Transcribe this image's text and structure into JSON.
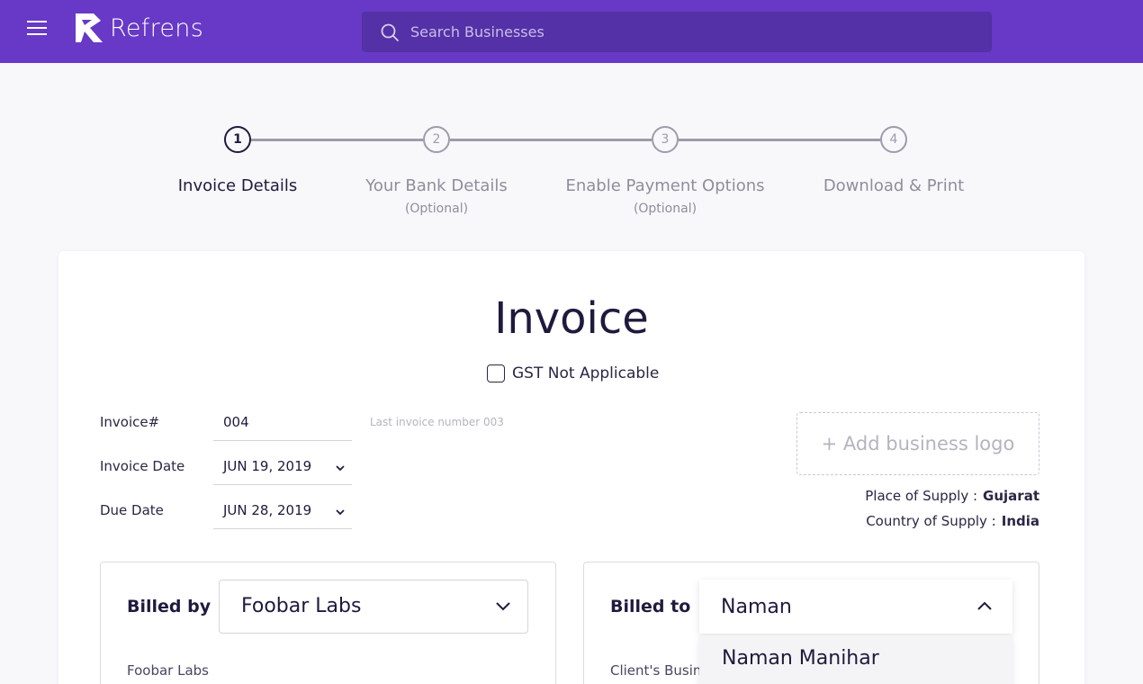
{
  "brand": {
    "name": "Refrens",
    "color": "#6739c6"
  },
  "search": {
    "placeholder": "Search Businesses"
  },
  "steps": [
    {
      "number": "1",
      "label": "Invoice Details",
      "sub": ""
    },
    {
      "number": "2",
      "label": "Your Bank Details",
      "sub": "(Optional)"
    },
    {
      "number": "3",
      "label": "Enable Payment Options",
      "sub": "(Optional)"
    },
    {
      "number": "4",
      "label": "Download & Print",
      "sub": ""
    }
  ],
  "invoice": {
    "title": "Invoice",
    "gst_label": "GST Not Applicable",
    "gst_checked": false,
    "number_label": "Invoice#",
    "number_value": "004",
    "number_hint": "Last invoice number 003",
    "date_label": "Invoice Date",
    "date_value": "JUN 19, 2019",
    "due_label": "Due Date",
    "due_value": "JUN 28, 2019",
    "add_logo": "+ Add business logo",
    "place_label": "Place of Supply :",
    "place_value": "Gujarat",
    "country_label": "Country of Supply :",
    "country_value": "India"
  },
  "billed_by": {
    "title": "Billed by",
    "selected": "Foobar Labs",
    "business_name": "Foobar Labs"
  },
  "billed_to": {
    "title": "Billed to",
    "input_value": "Naman",
    "sub_label": "Client's Business",
    "options": [
      "Naman Manihar"
    ]
  }
}
